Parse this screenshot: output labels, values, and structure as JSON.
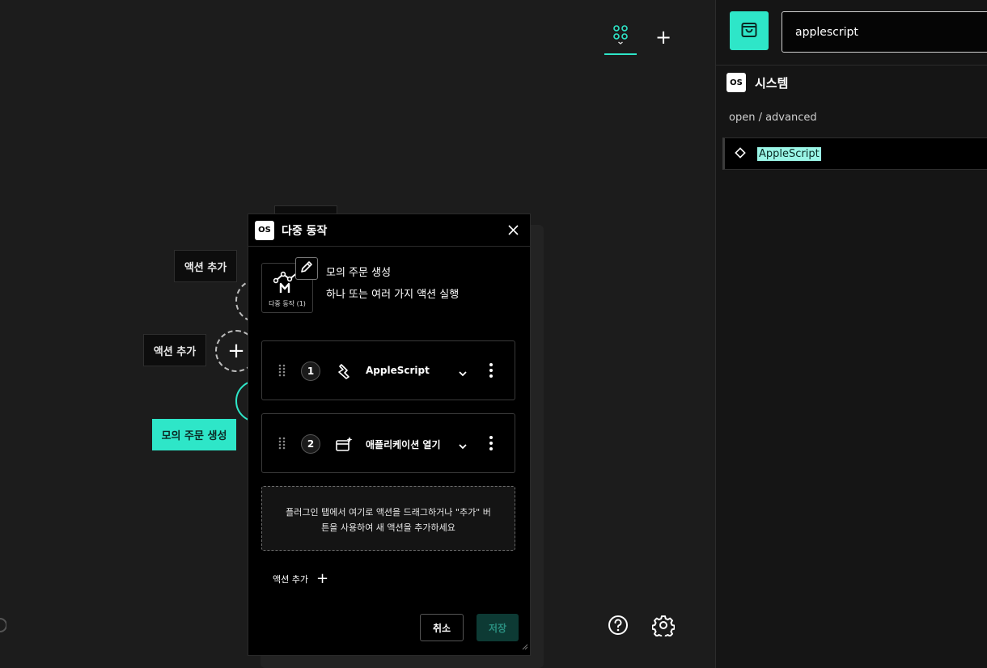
{
  "toolbar": {
    "add_symbol": "+"
  },
  "canvas": {
    "add_action_label_1": "액션 추가",
    "add_action_label_2": "액션 추가",
    "add_symbol": "+",
    "selected_label": "모의 주문 생성"
  },
  "right_panel": {
    "search": {
      "value": "applescript"
    },
    "section": {
      "badge": "OS",
      "title": "시스템"
    },
    "breadcrumb": "open / advanced",
    "results": [
      {
        "label": "AppleScript"
      }
    ]
  },
  "dialog": {
    "badge": "OS",
    "title": "다중 동작",
    "macro": {
      "icon_caption": "다중 동작 (1)",
      "name": "모의 주문 생성",
      "description": "하나 또는 여러 가지 액션 실행"
    },
    "actions": [
      {
        "number": "1",
        "name": "AppleScript",
        "icon": "applescript-icon"
      },
      {
        "number": "2",
        "name": "애플리케이션 열기",
        "icon": "open-app-icon"
      }
    ],
    "drop_zone_line1": "플러그인 탭에서 여기로 액션을 드래그하거나 \"추가\" 버",
    "drop_zone_line2": "튼을 사용하여 새 액션을 추가하세요",
    "add_action_label": "액션 추가",
    "add_symbol": "+",
    "cancel_label": "취소",
    "save_label": "저장"
  },
  "colors": {
    "accent": "#2ee6c8",
    "panel_bg": "#151515",
    "canvas_bg": "#1c1c1c"
  }
}
